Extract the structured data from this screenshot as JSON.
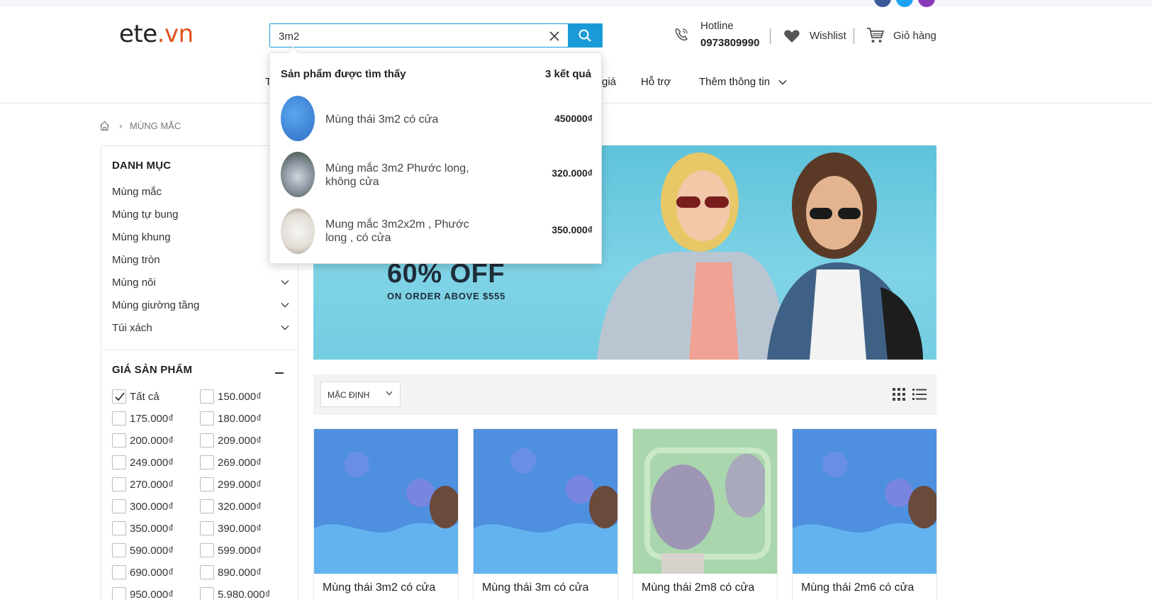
{
  "header": {
    "logo_main": "ete",
    "logo_domain": ".vn",
    "search_value": "3m2",
    "hotline_label": "Hotline",
    "hotline_number": "0973809990",
    "wishlist_label": "Wishlist",
    "cart_label": "Giỏ hàng"
  },
  "nav": {
    "items": [
      "T",
      "giá",
      "Hỗ trợ",
      "Thêm thông tin"
    ]
  },
  "breadcrumb": {
    "current": "MÙNG MẮC"
  },
  "categories": {
    "title": "DANH MỤC",
    "items": [
      "Mùng mắc",
      "Mùng tự bung",
      "Mùng khung",
      "Mùng tròn",
      "Mùng nôi",
      "Mùng giường tầng",
      "Túi xách"
    ]
  },
  "price_filter": {
    "title": "GIÁ SẢN PHẨM",
    "options": [
      "Tất cả",
      "150.000₫",
      "175.000₫",
      "180.000₫",
      "200.000₫",
      "209.000₫",
      "249.000₫",
      "269.000₫",
      "270.000₫",
      "299.000₫",
      "300.000₫",
      "320.000₫",
      "350.000₫",
      "390.000₫",
      "590.000₫",
      "599.000₫",
      "690.000₫",
      "890.000₫",
      "950.000₫",
      "5.980.000₫"
    ]
  },
  "banner": {
    "headline": "60% OFF",
    "subline": "ON ORDER ABOVE $555"
  },
  "sort": {
    "selected": "MẶC ĐỊNH"
  },
  "products": [
    {
      "name": "Mùng thái 3m2 có cửa"
    },
    {
      "name": "Mùng thái 3m có cửa"
    },
    {
      "name": "Mùng thái 2m8 có cửa"
    },
    {
      "name": "Mùng thái 2m6 có cửa"
    }
  ],
  "search_results": {
    "title": "Sản phẩm được tìm thấy",
    "count": "3 kết quả",
    "items": [
      {
        "name": "Mùng thái 3m2 có cửa",
        "price": "450000₫"
      },
      {
        "name": "Mùng mắc 3m2 Phước long, không cửa",
        "price": "320.000₫"
      },
      {
        "name": "Mung mắc 3m2x2m , Phước long , có cửa",
        "price": "350.000₫"
      }
    ]
  },
  "colors": {
    "accent": "#1a9bd7",
    "logo_domain": "#e0521b",
    "banner_bg": "#6dcbe0"
  }
}
